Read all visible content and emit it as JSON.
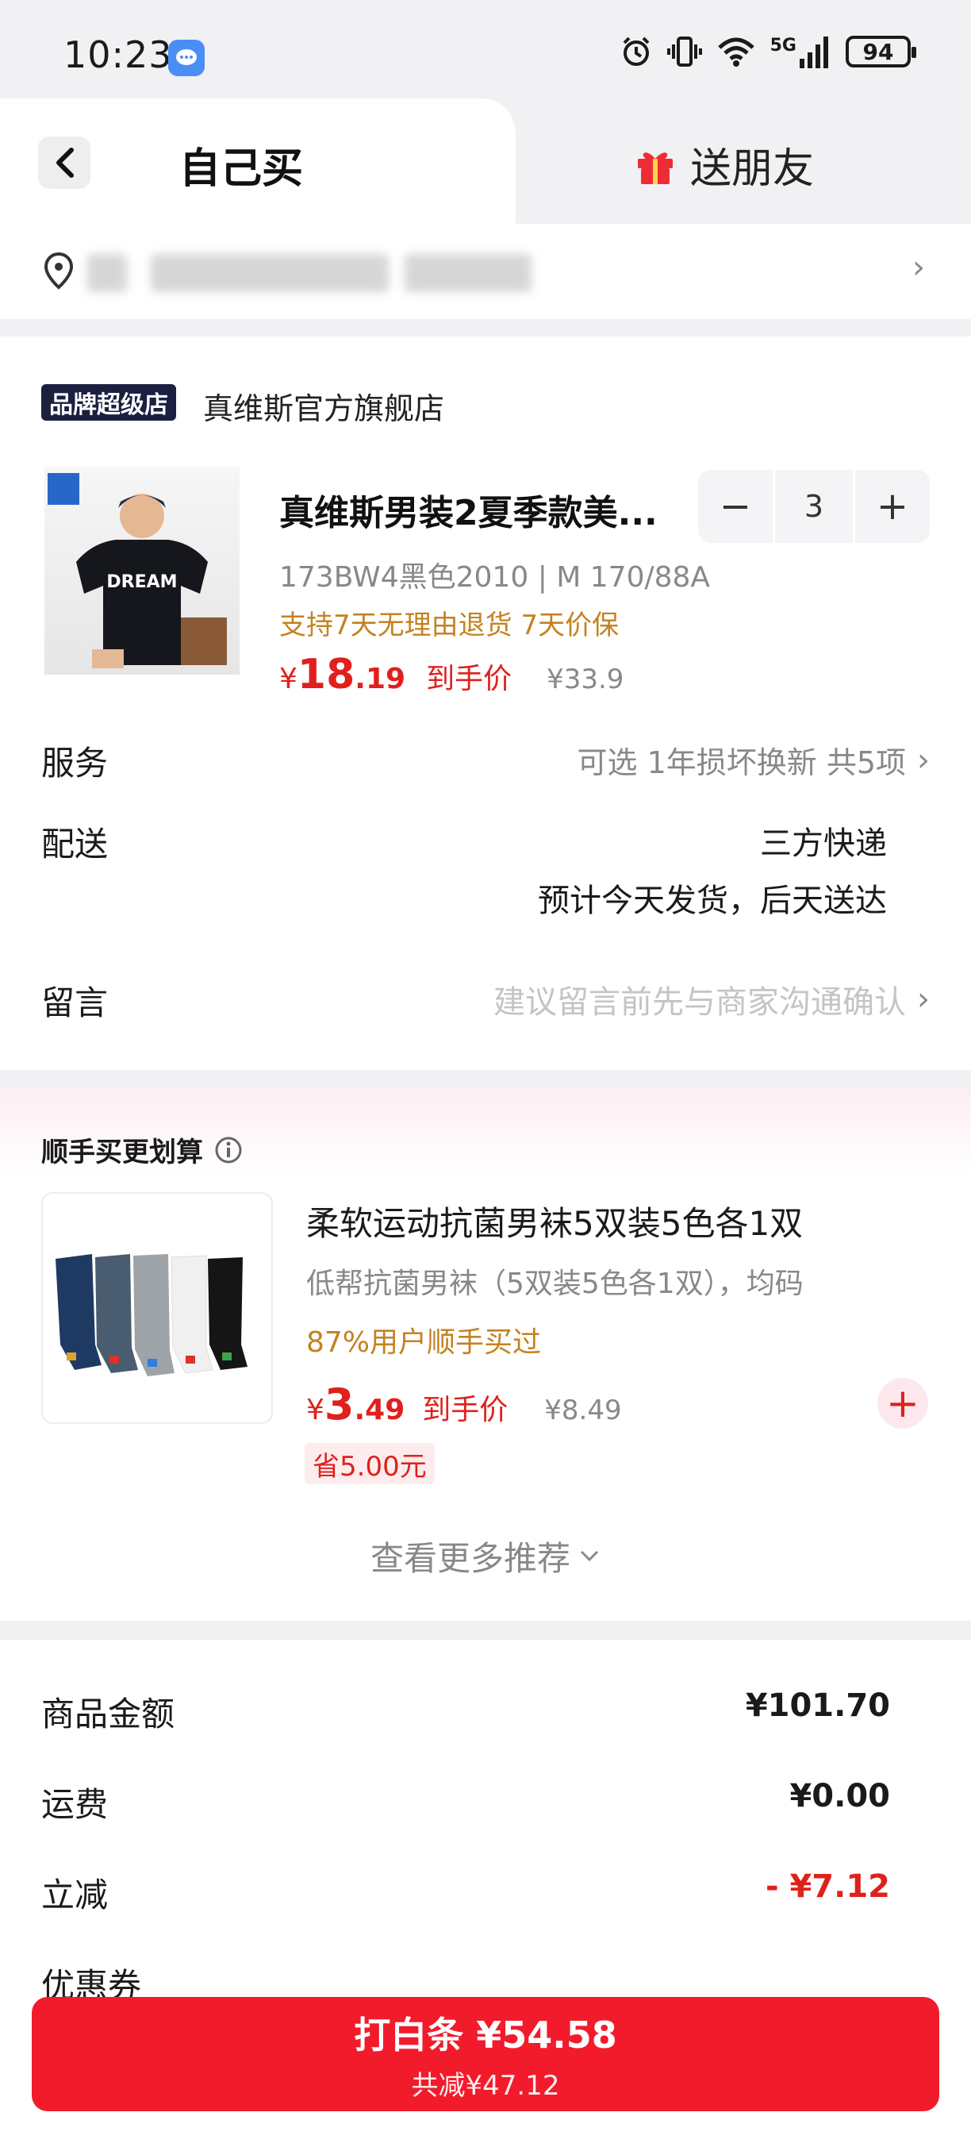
{
  "status_bar": {
    "time": "10:23",
    "network": "5G",
    "battery": "94"
  },
  "header": {
    "tab_self": "自己买",
    "tab_gift": "送朋友"
  },
  "store": {
    "badge": "品牌超级店",
    "name": "真维斯官方旗舰店"
  },
  "product": {
    "title": "真维斯男装2夏季款美...",
    "spec": "173BW4黑色2010 | M 170/88A",
    "tags": "支持7天无理由退货 7天价保",
    "price_symbol": "¥",
    "price_int": "18",
    "price_dec": ".19",
    "price_label": "到手价",
    "orig_price": "¥33.9",
    "quantity": "3",
    "shirt_text": "DREAM"
  },
  "rows": {
    "service_label": "服务",
    "service_value": "可选 1年损坏换新 共5项",
    "delivery_label": "配送",
    "delivery_value_1": "三方快递",
    "delivery_value_2": "预计今天发货，后天送达",
    "message_label": "留言",
    "message_placeholder": "建议留言前先与商家沟通确认"
  },
  "addon": {
    "header": "顺手买更划算",
    "title": "柔软运动抗菌男袜5双装5色各1双",
    "desc": "低帮抗菌男袜（5双装5色各1双），均码",
    "social": "87%用户顺手买过",
    "price_symbol": "¥",
    "price_int": "3",
    "price_dec": ".49",
    "price_label": "到手价",
    "orig_price": "¥8.49",
    "save": "省5.00元",
    "more": "查看更多推荐"
  },
  "summary": {
    "goods_label": "商品金额",
    "goods_value": "¥101.70",
    "shipping_label": "运费",
    "shipping_value": "¥0.00",
    "discount_label": "立减",
    "discount_value": "- ¥7.12",
    "coupon_label": "优惠券"
  },
  "pay": {
    "main": "打白条 ¥54.58",
    "sub": "共减¥47.12"
  },
  "colors": {
    "accent_red": "#e0201c",
    "button_red": "#f21b2c",
    "tag_orange": "#c4821f",
    "badge_navy": "#1c1f3f"
  }
}
